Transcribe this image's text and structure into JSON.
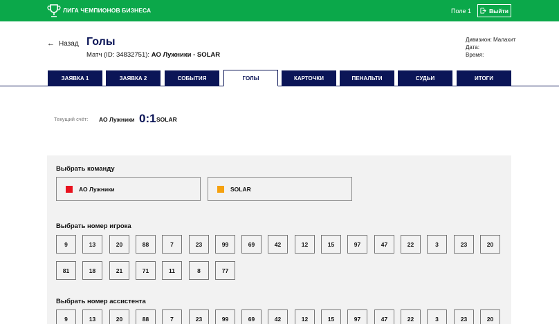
{
  "header": {
    "brand": "ЛИГА ЧЕМПИОНОВ БИЗНЕСА",
    "field": "Поле 1",
    "logout_label": "Выйти",
    "color": "#0ba84a"
  },
  "page": {
    "back_label": "Назад",
    "title": "Голы",
    "match_prefix": "Матч (ID: 34832751):",
    "match_teams": "АО Лужники - SOLAR",
    "division": "Дивизион: Малахит",
    "date": "Дата:",
    "time": "Время:"
  },
  "tabs": [
    "ЗАЯВКА 1",
    "ЗАЯВКА 2",
    "СОБЫТИЯ",
    "ГОЛЫ",
    "КАРТОЧКИ",
    "ПЕНАЛЬТИ",
    "СУДЬИ",
    "ИТОГИ"
  ],
  "active_tab": "ГОЛЫ",
  "score": {
    "label": "Текущий счёт:",
    "team1": "АО Лужники",
    "value": "0:1",
    "team2": "SOLAR"
  },
  "select_team": {
    "title": "Выбрать команду",
    "teams": [
      {
        "name": "АО Лужники",
        "color": "#e8121e"
      },
      {
        "name": "SOLAR",
        "color": "#f5a10f"
      }
    ]
  },
  "select_player": {
    "title": "Выбрать номер игрока",
    "numbers": [
      "9",
      "13",
      "20",
      "88",
      "7",
      "23",
      "99",
      "69",
      "42",
      "12",
      "15",
      "97",
      "47",
      "22",
      "3",
      "23",
      "20",
      "81",
      "18",
      "21",
      "71",
      "11",
      "8",
      "77"
    ]
  },
  "select_assistant": {
    "title": "Выбрать номер ассистента",
    "numbers": [
      "9",
      "13",
      "20",
      "88",
      "7",
      "23",
      "99",
      "69",
      "42",
      "12",
      "15",
      "97",
      "47",
      "22",
      "3",
      "23",
      "20"
    ]
  }
}
